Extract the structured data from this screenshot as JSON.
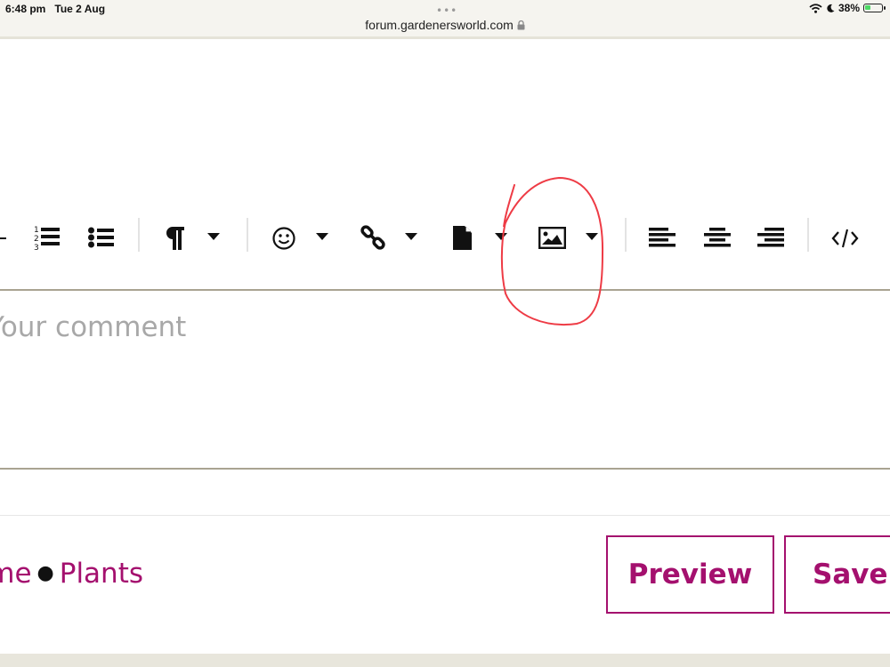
{
  "status_bar": {
    "time": "6:48 pm",
    "date": "Tue 2 Aug",
    "url": "forum.gardenersworld.com",
    "battery": "38%",
    "battery_level": 0.38
  },
  "toolbar": {
    "icons": [
      "minus-icon",
      "ordered-list-icon",
      "bulleted-list-icon",
      "paragraph-icon",
      "emoji-icon",
      "link-icon",
      "file-icon",
      "image-icon",
      "align-left-icon",
      "align-center-icon",
      "align-right-icon",
      "code-icon"
    ]
  },
  "editor": {
    "placeholder": "Your comment"
  },
  "breadcrumbs": [
    {
      "label": "Home"
    },
    {
      "label": "Plants"
    }
  ],
  "buttons": {
    "preview": "Preview",
    "save": "Save comment"
  },
  "colors": {
    "accent": "#a4106e",
    "divider": "#a9a391",
    "annotation": "#ee3b45"
  }
}
